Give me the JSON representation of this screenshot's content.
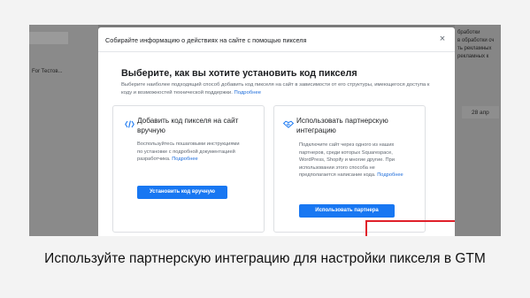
{
  "background": {
    "left_label": "For Тестов...",
    "right_lines": [
      "бработки",
      "в обработки сч",
      "ть рекламных",
      "рекламных к"
    ],
    "date_chip": "28 апр"
  },
  "modal": {
    "title": "Собирайте информацию о действиях на сайте с помощью пикселя",
    "close_icon": "×",
    "heading": "Выберите, как вы хотите установить код пикселя",
    "description": "Выберите наиболее подходящий способ добавить код пикселя на сайт в зависимости от его структуры, имеющегося доступа к коду и возможностей технической поддержки.",
    "description_link": "Подробнее",
    "manual": {
      "icon": "code-icon",
      "title": "Добавить код пикселя на сайт вручную",
      "text": "Воспользуйтесь пошаговыми инструкциями по установке с подробной документацией разработчика.",
      "link": "Подробнее",
      "button": "Установить код вручную"
    },
    "partner": {
      "icon": "handshake-icon",
      "title": "Использовать партнерскую интеграцию",
      "text": "Подключите сайт через одного из наших партнеров, среди которых Squarespace, WordPress, Shopify и многие другие. При использовании этого способа не предполагается написание кода.",
      "link": "Подробнее",
      "button": "Использовать партнера"
    }
  },
  "highlight_color": "#e0202a",
  "accent_color": "#1877f2",
  "caption": "Используйте партнерскую интеграцию для настройки пикселя в GTM"
}
